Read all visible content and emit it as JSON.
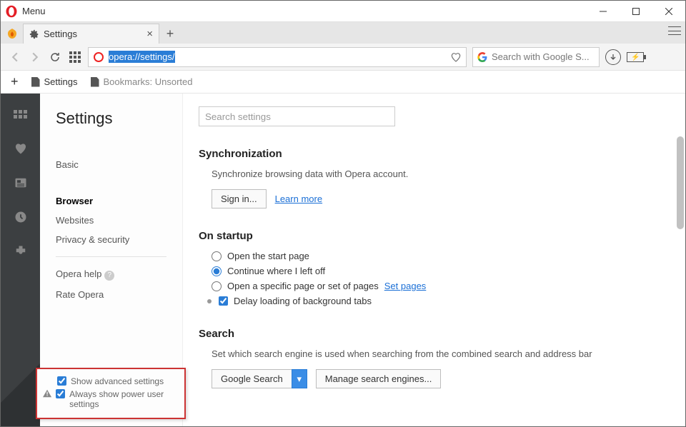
{
  "titlebar": {
    "menu": "Menu"
  },
  "tabs": {
    "active_label": "Settings"
  },
  "url": "opera://settings/",
  "search_box": {
    "placeholder": "Search with Google S..."
  },
  "bookmarks": {
    "settings": "Settings",
    "unsorted": "Bookmarks: Unsorted"
  },
  "sidebar": {
    "title": "Settings",
    "items": [
      "Basic",
      "Browser",
      "Websites",
      "Privacy & security"
    ],
    "help": "Opera help",
    "rate": "Rate Opera"
  },
  "advanced": {
    "show_advanced": "Show advanced settings",
    "power_user": "Always show power user settings"
  },
  "content": {
    "search_placeholder": "Search settings",
    "sync": {
      "title": "Synchronization",
      "desc": "Synchronize browsing data with Opera account.",
      "signin": "Sign in...",
      "learn": "Learn more"
    },
    "startup": {
      "title": "On startup",
      "opt1": "Open the start page",
      "opt2": "Continue where I left off",
      "opt3": "Open a specific page or set of pages",
      "setpages": "Set pages",
      "delay": "Delay loading of background tabs"
    },
    "search": {
      "title": "Search",
      "desc": "Set which search engine is used when searching from the combined search and address bar",
      "engine": "Google Search",
      "manage": "Manage search engines..."
    }
  }
}
